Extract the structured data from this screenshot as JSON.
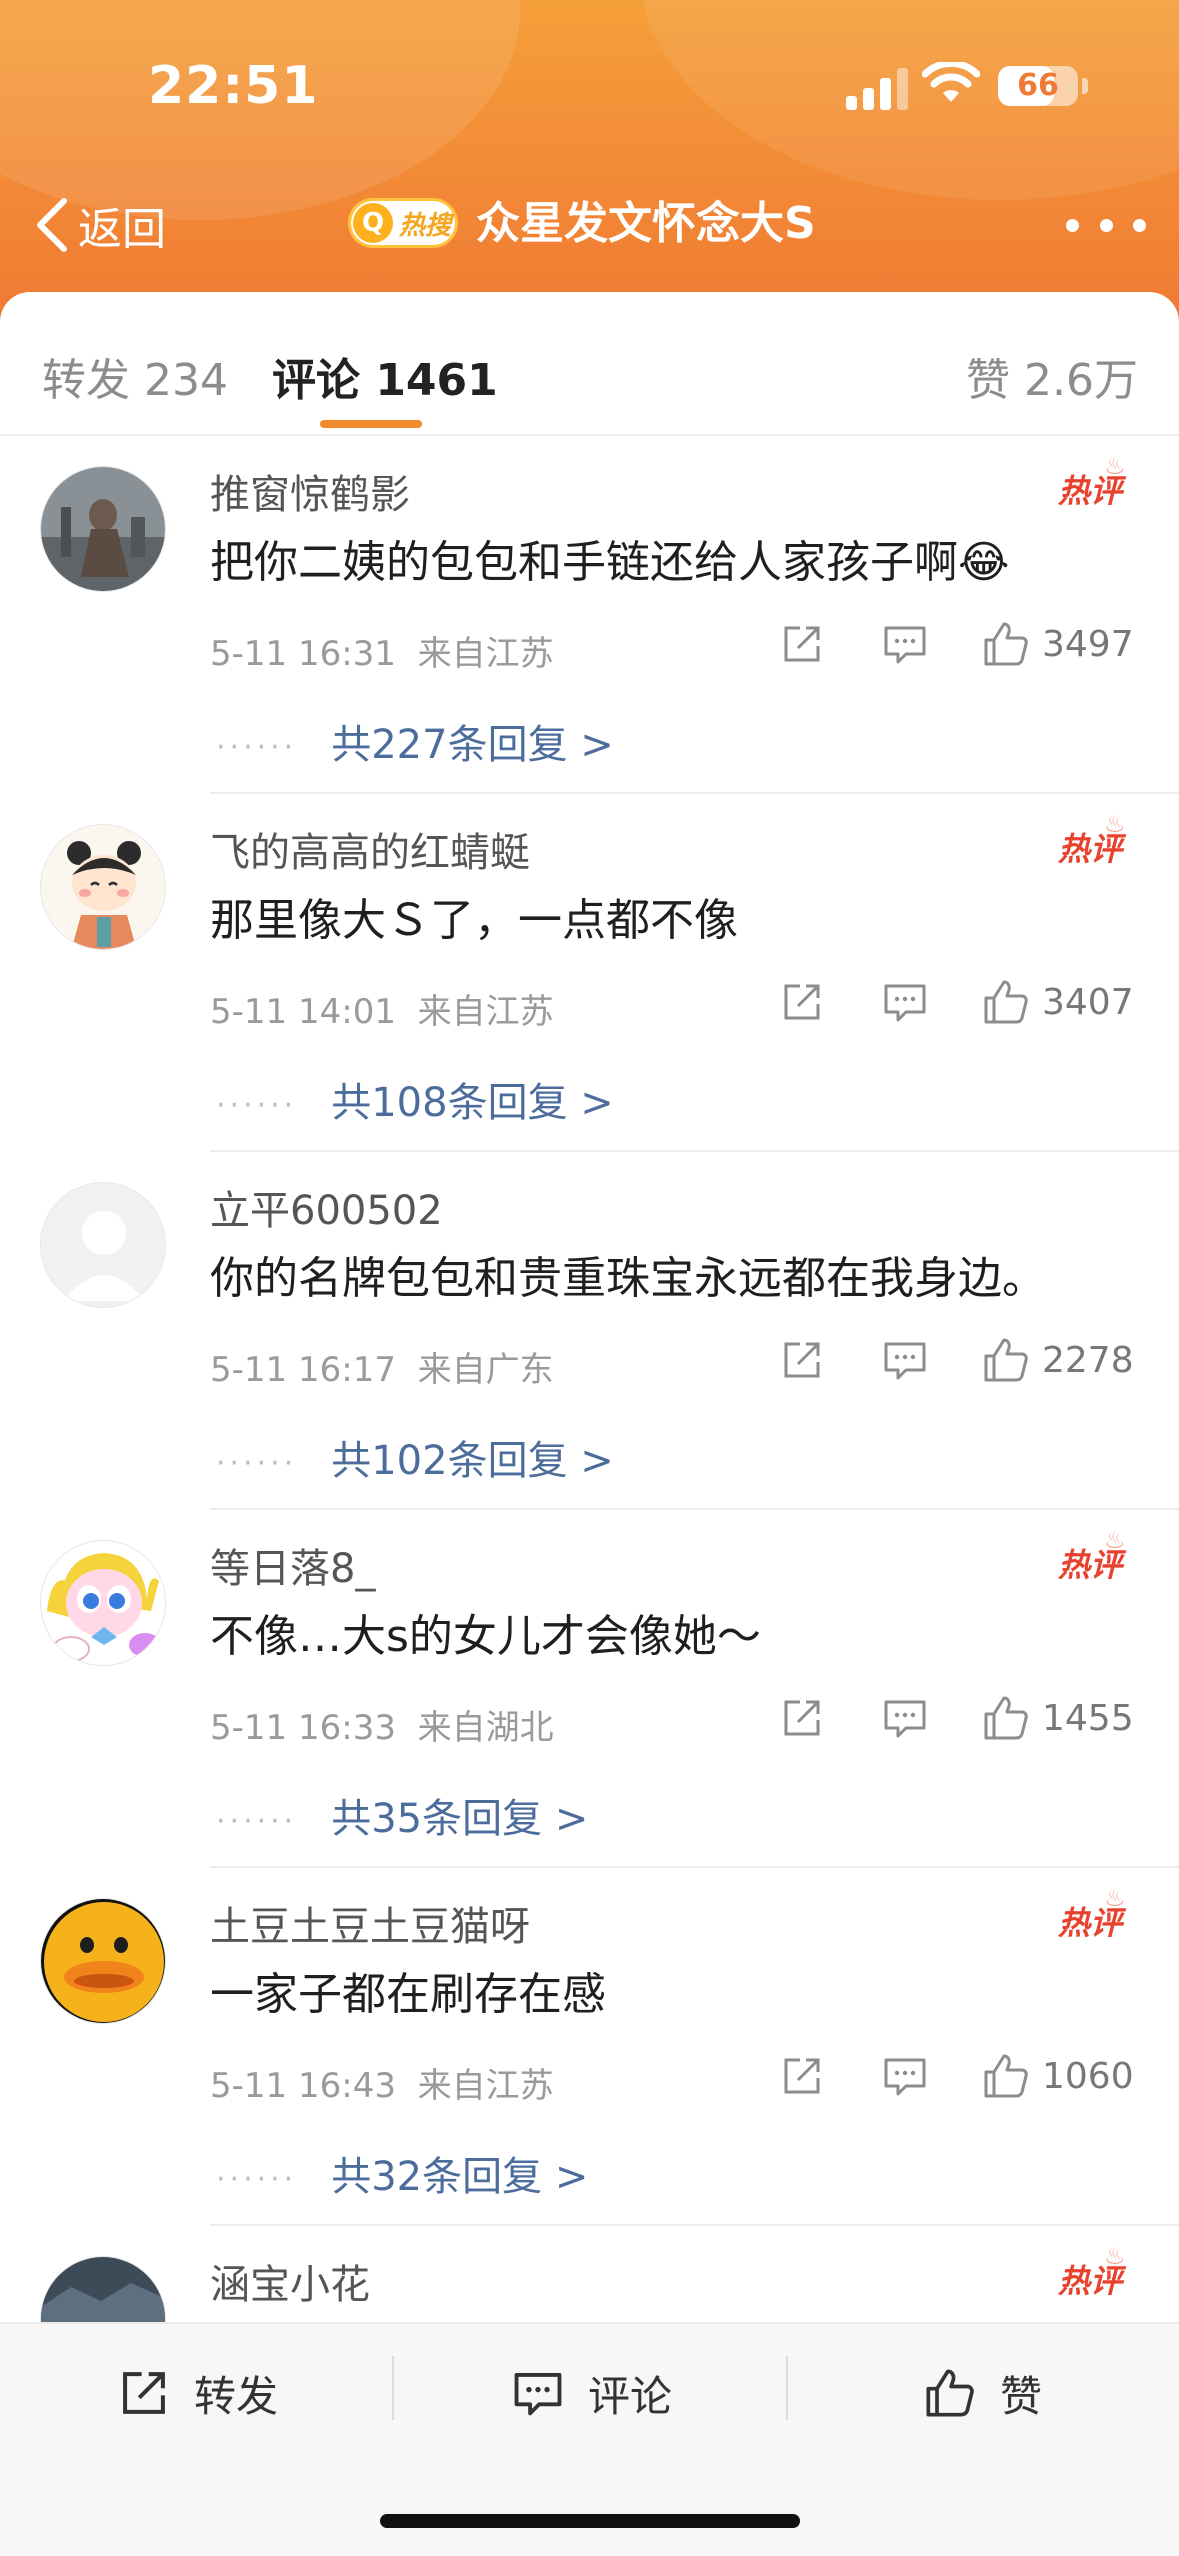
{
  "status_bar": {
    "time": "22:51",
    "battery": "66"
  },
  "nav": {
    "back_label": "返回",
    "hot_badge": "热搜",
    "title": "众星发文怀念大S"
  },
  "tabs": {
    "repost": "转发 234",
    "comments": "评论 1461",
    "likes": "赞 2.6万"
  },
  "comments": [
    {
      "user": "推窗惊鹤影",
      "text": "把你二姨的包包和手链还给人家孩子啊😂",
      "time": "5-11 16:31",
      "location": "来自江苏",
      "likes": "3497",
      "replies": "共227条回复 >",
      "hot": "热评"
    },
    {
      "user": "飞的高高的红蜻蜓",
      "text": "那里像大Ｓ了，一点都不像",
      "time": "5-11 14:01",
      "location": "来自江苏",
      "likes": "3407",
      "replies": "共108条回复 >",
      "hot": "热评"
    },
    {
      "user": "立平600502",
      "text": "你的名牌包包和贵重珠宝永远都在我身边。",
      "time": "5-11 16:17",
      "location": "来自广东",
      "likes": "2278",
      "replies": "共102条回复 >",
      "hot": ""
    },
    {
      "user": "等日落8_",
      "text": "不像…大s的女儿才会像她～",
      "time": "5-11 16:33",
      "location": "来自湖北",
      "likes": "1455",
      "replies": "共35条回复 >",
      "hot": "热评"
    },
    {
      "user": "土豆土豆土豆猫呀",
      "text": "一家子都在刷存在感",
      "time": "5-11 16:43",
      "location": "来自江苏",
      "likes": "1060",
      "replies": "共32条回复 >",
      "hot": "热评"
    },
    {
      "user": "涵宝小花",
      "text": "",
      "time": "",
      "location": "",
      "likes": "",
      "replies": "",
      "hot": "热评"
    }
  ],
  "bottom_bar": {
    "repost": "转发",
    "comment": "评论",
    "like": "赞"
  },
  "colors": {
    "accent": "#f08a2a",
    "header": "#f28a36",
    "hot": "#e8422f",
    "link": "#4c6d9c"
  }
}
